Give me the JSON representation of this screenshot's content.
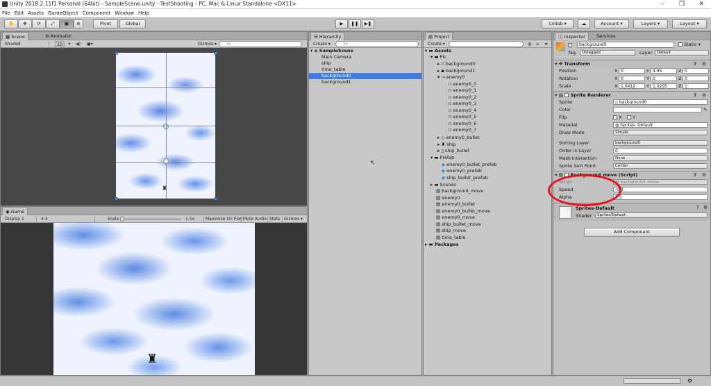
{
  "window": {
    "title": "Unity 2018.2.11f1 Personal (64bit) - SampleScene.unity - TestShooting - PC, Mac & Linux Standalone <DX11>"
  },
  "menu": [
    "File",
    "Edit",
    "Assets",
    "GameObject",
    "Component",
    "Window",
    "Help"
  ],
  "toolbar": {
    "pivot": "Pivot",
    "global": "Global",
    "collab": "Collab ▾",
    "account": "Account",
    "layers": "Layers",
    "layout": "Layout"
  },
  "scene": {
    "tab": "Scene",
    "tab2": "Animator",
    "shading": "Shaded",
    "mode2d": "2D",
    "gizmos": "Gizmos ▾",
    "search": "All"
  },
  "game": {
    "tab": "Game",
    "display": "Display 1",
    "aspect": "4:3",
    "scale_label": "Scale",
    "scale_value": "1.5x",
    "maximize": "Maximize On Play",
    "mute": "Mute Audio",
    "stats": "Stats",
    "gizmos": "Gizmos ▾"
  },
  "hierarchy": {
    "tab": "Hierarchy",
    "create": "Create ▾",
    "search": "All",
    "scene": "SampleScene",
    "items": [
      "Main Camera",
      "ship",
      "time_table",
      "background0",
      "background1"
    ],
    "selected_index": 3
  },
  "project": {
    "tab": "Project",
    "create": "Create ▾",
    "root": "Assets",
    "pic": "Pic",
    "pic_items": [
      "background0",
      "background1"
    ],
    "enemy0": "enemy0",
    "enemy_frames": [
      "enemy0_0",
      "enemy0_1",
      "enemy0_2",
      "enemy0_3",
      "enemy0_4",
      "enemy0_5",
      "enemy0_6",
      "enemy0_7"
    ],
    "pic_more": [
      "enemy0_bullet",
      "ship",
      "ship_bullet"
    ],
    "prefab": "Prefab",
    "prefab_items": [
      "enemy0_bullet_prefab",
      "enemy0_prefab",
      "ship_bullet_prefab"
    ],
    "scenes": "Scenes",
    "scripts": [
      "background_move",
      "enemy0",
      "enemy0_bullet",
      "enemy0_bullet_move",
      "enemy0_move",
      "ship_bullet_move",
      "ship_move",
      "time_table"
    ],
    "packages": "Packages"
  },
  "inspector": {
    "tab": "Inspector",
    "tab2": "Services",
    "name": "background0",
    "static": "Static ▾",
    "tag_label": "Tag",
    "tag": "Untagged",
    "layer_label": "Layer",
    "layer": "Default",
    "transform": {
      "title": "Transform",
      "position": {
        "label": "Position",
        "x": "0",
        "y": "4.95",
        "z": "0"
      },
      "rotation": {
        "label": "Rotation",
        "x": "0",
        "y": "0",
        "z": "0"
      },
      "scale": {
        "label": "Scale",
        "x": "1.0412",
        "y": "1.0295",
        "z": "1"
      }
    },
    "sprite_renderer": {
      "title": "Sprite Renderer",
      "sprite_label": "Sprite",
      "sprite": "background0",
      "color_label": "Color",
      "flip_label": "Flip",
      "flip_x": "X",
      "flip_y": "Y",
      "material_label": "Material",
      "material": "Sprites- Default",
      "draw_mode_label": "Draw Mode",
      "draw_mode": "Simple",
      "sorting_layer_label": "Sorting Layer",
      "sorting_layer": "background0",
      "order_label": "Order in Layer",
      "order": "0",
      "mask_label": "Mask Interaction",
      "mask": "None",
      "sort_point_label": "Sprite Sort Point",
      "sort_point": "Center"
    },
    "script": {
      "title": "Background_move (Script)",
      "script_label": "Script",
      "script": "background_move",
      "speed_label": "Speed",
      "speed": "-0.3",
      "alpha_label": "Alpha",
      "alpha": "0.5"
    },
    "material": {
      "name": "Sprites-Default",
      "shader_label": "Shader",
      "shader": "Sprites/Default"
    },
    "add_component": "Add Component"
  },
  "colors": {
    "highlight_circle": "#e8101a",
    "selection": "#3d7ce0"
  }
}
